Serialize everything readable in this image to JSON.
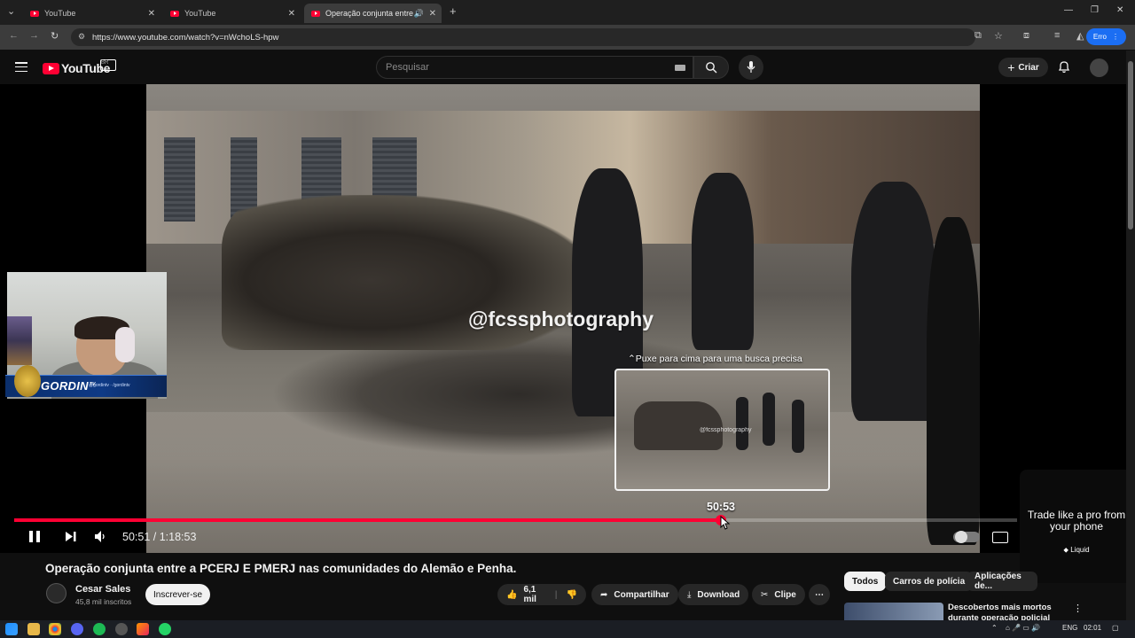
{
  "browser": {
    "tabs": [
      {
        "title": "YouTube",
        "active": false
      },
      {
        "title": "YouTube",
        "active": false
      },
      {
        "title": "Operação conjunta entre a",
        "active": true
      }
    ],
    "url": "https://www.youtube.com/watch?v=nWchoLS-hpw",
    "profile_label": "Erro"
  },
  "youtube": {
    "logo_text": "YouTube",
    "country_code": "BR",
    "search_placeholder": "Pesquisar",
    "create_label": "Criar"
  },
  "player": {
    "watermark": "@fcssphotography",
    "seek_hint": "⌃Puxe para cima para uma busca precisa",
    "preview_time": "50:53",
    "current_time": "50:51",
    "duration": "1:18:53",
    "progress_fraction": 0.705,
    "accent_color": "#ff0033"
  },
  "overlay": {
    "streamer_name": "GORDIN",
    "streamer_badge": "TV",
    "handle_text": "@gordintv · /gordintv"
  },
  "ad": {
    "headline": "Trade like a pro from your phone",
    "brand": "Liquid"
  },
  "video": {
    "title": "Operação conjunta entre a PCERJ E PMERJ nas comunidades do Alemão e Penha.",
    "channel": "Cesar Sales",
    "subscribers": "45,8 mil inscritos",
    "subscribe_label": "Inscrever-se",
    "likes": "6,1 mil",
    "share_label": "Compartilhar",
    "download_label": "Download",
    "clip_label": "Clipe"
  },
  "filters": {
    "chips": [
      "Todos",
      "Carros de polícia",
      "Aplicações de..."
    ]
  },
  "recommendations": [
    {
      "title": "Descobertos mais mortos durante operação policial no"
    }
  ],
  "taskbar": {
    "language": "ENG",
    "clock": "02:01"
  }
}
